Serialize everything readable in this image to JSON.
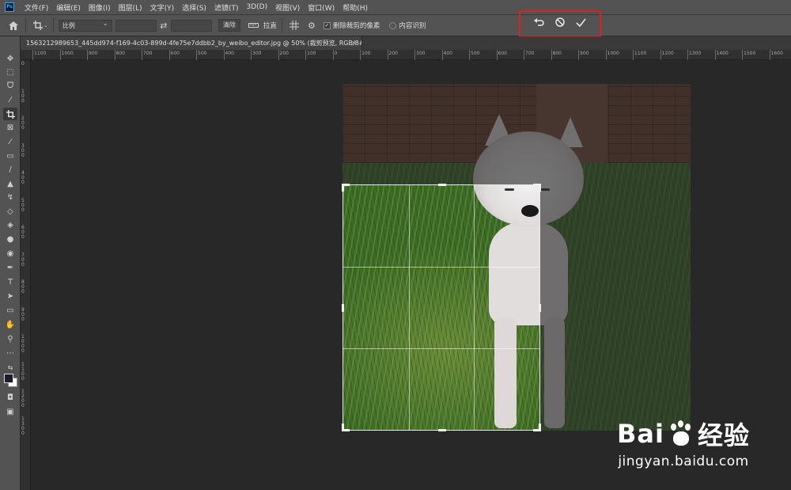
{
  "app": {
    "logo": "Ps",
    "menu": [
      "文件(F)",
      "编辑(E)",
      "图像(I)",
      "图层(L)",
      "文字(Y)",
      "选择(S)",
      "滤镜(T)",
      "3D(D)",
      "视图(V)",
      "窗口(W)",
      "帮助(H)"
    ]
  },
  "options": {
    "home_icon": "home-icon",
    "crop_tool_icon": "crop-icon",
    "ratio_select": "比例",
    "swap_icon": "swap-arrows-icon",
    "clear_button": "清除",
    "straighten_label": "拉直",
    "overlay_icon": "grid-overlay-icon",
    "settings_icon": "gear-icon",
    "delete_cropped_label": "删除裁剪的像素",
    "delete_cropped_checked": true,
    "content_aware_label": "内容识别",
    "content_aware_checked": false,
    "commit": {
      "reset_icon": "undo-icon",
      "cancel_icon": "cancel-icon",
      "commit_icon": "checkmark-icon"
    }
  },
  "document": {
    "tab_title": "1563212989653_445dd974-f169-4c03-899d-4fe75e7ddbb2_by_weibo_editor.jpg @ 50% (裁剪预览, RGB/8#)",
    "close_glyph": "×"
  },
  "ruler": {
    "horizontal": [
      "1100",
      "1000",
      "900",
      "800",
      "700",
      "600",
      "500",
      "400",
      "300",
      "200",
      "100",
      "0",
      "100",
      "200",
      "300",
      "400",
      "500",
      "600",
      "700",
      "800",
      "900",
      "1000",
      "1100",
      "1200",
      "1300",
      "1400",
      "1500",
      "1600"
    ],
    "vertical": [
      "0",
      "100",
      "200",
      "300",
      "400",
      "500",
      "600",
      "700",
      "800",
      "900",
      "1000",
      "1100",
      "1200",
      "1300"
    ]
  },
  "tools": [
    "move-icon",
    "marquee-icon",
    "lasso-icon",
    "magic-wand-icon",
    "crop-icon",
    "frame-icon",
    "eyedropper-icon",
    "healing-icon",
    "brush-icon",
    "stamp-icon",
    "history-brush-icon",
    "eraser-icon",
    "bucket-icon",
    "blur-icon",
    "dodge-icon",
    "pen-icon",
    "type-icon",
    "path-select-icon",
    "rectangle-icon",
    "hand-icon",
    "zoom-icon",
    "more-icon",
    "swap-colors-icon",
    "color-swatch-icon",
    "quickmask-icon",
    "screen-mode-icon"
  ],
  "watermark": {
    "brand_a": "Bai",
    "brand_b": "经验",
    "url": "jingyan.baidu.com"
  },
  "colors": {
    "highlight": "#e0201d",
    "panel": "#535353",
    "canvas": "#282828"
  }
}
